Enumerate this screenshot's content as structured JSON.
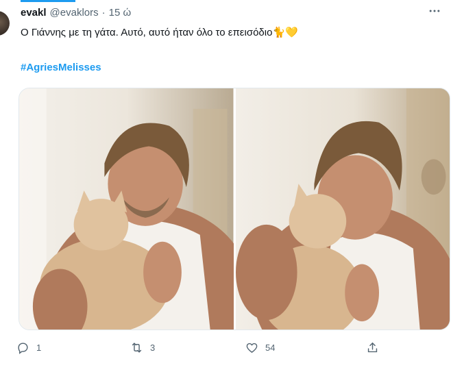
{
  "tweet": {
    "author_name": "evakl",
    "author_handle": "@evaklors",
    "separator": "·",
    "time": "15 ώ",
    "text": "Ο Γιάννης με τη γάτα. Αυτό, αυτό ήταν όλο το επεισόδιο",
    "emojis": "🐈💛",
    "hashtag": "#AgriesMelisses",
    "more_icon": "more-horizontal-icon"
  },
  "stats": {
    "replies": "1",
    "retweets": "3",
    "likes": "54"
  },
  "colors": {
    "accent": "#1d9bf0",
    "secondary_text": "#536471",
    "primary_text": "#0f1419"
  }
}
